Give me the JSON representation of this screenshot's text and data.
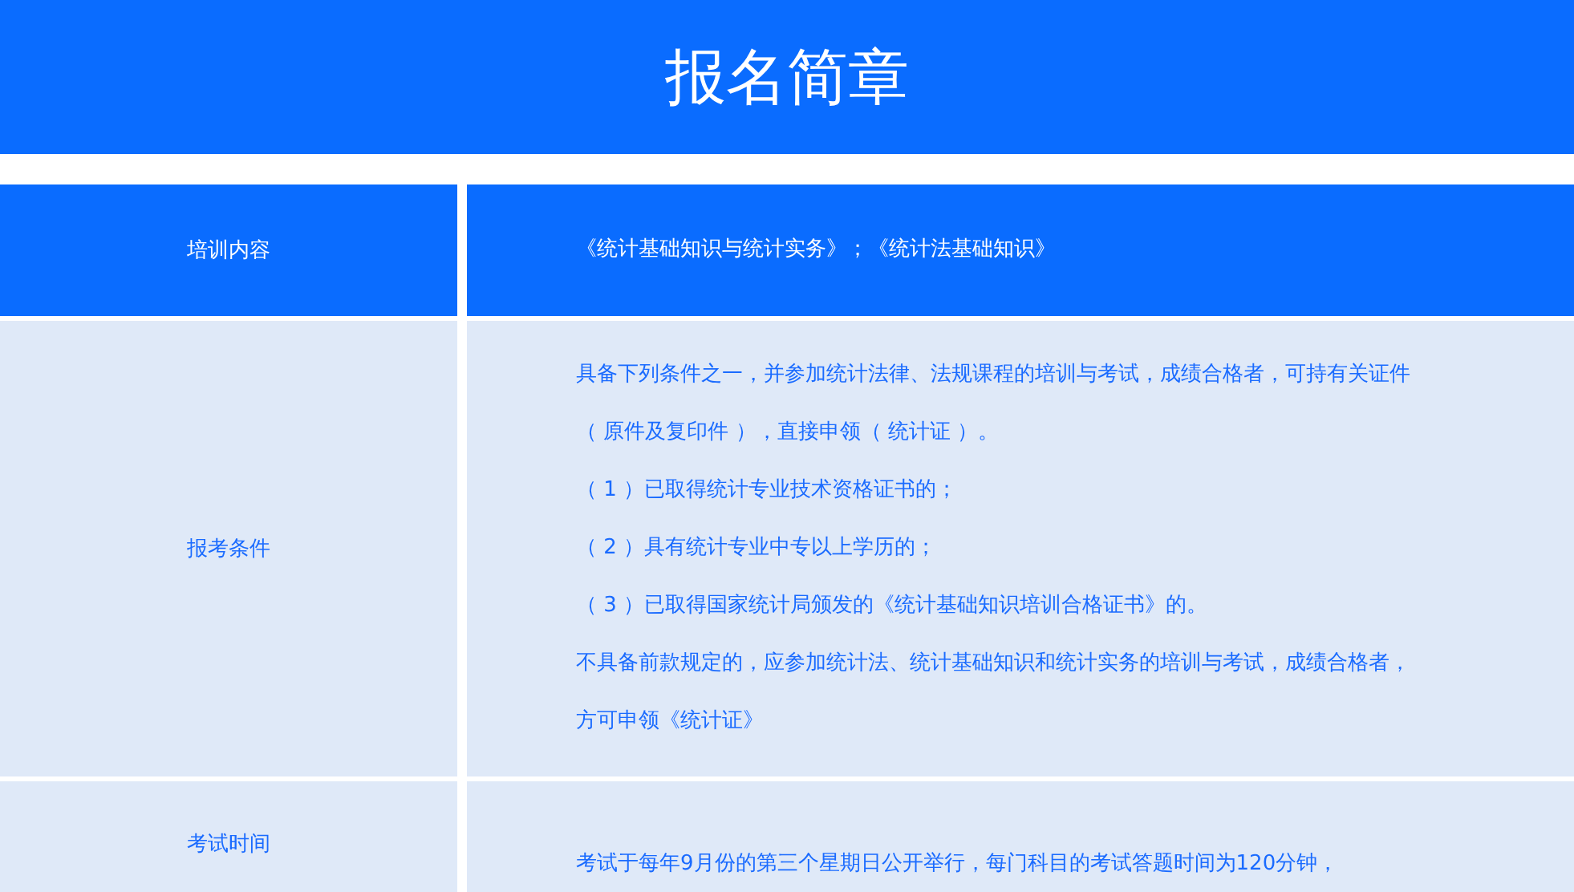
{
  "title": "报名简章",
  "rows": [
    {
      "kind": "header",
      "label": "培训内容",
      "lines": [
        "《统计基础知识与统计实务》；《统计法基础知识》"
      ]
    },
    {
      "kind": "body",
      "label": "报考条件",
      "lines": [
        "具备下列条件之一，并参加统计法律、法规课程的培训与考试，成绩合格者，可持有关证件",
        "（ 原件及复印件 ），直接申领（ 统计证 ）。",
        "（ 1 ）已取得统计专业技术资格证书的；",
        "（ 2 ）具有统计专业中专以上学历的；",
        "（ 3 ）已取得国家统计局颁发的《统计基础知识培训合格证书》的。",
        "不具备前款规定的，应参加统计法、统计基础知识和统计实务的培训与考试，成绩合格者，",
        "方可申领《统计证》"
      ]
    },
    {
      "kind": "body",
      "label": "考试时间",
      "lines": [
        "考试于每年9月份的第三个星期日公开举行，每门科目的考试答题时间为120分钟，"
      ]
    }
  ]
}
